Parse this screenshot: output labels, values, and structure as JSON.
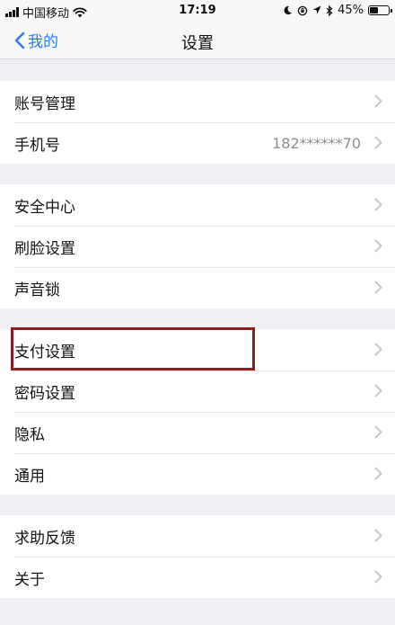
{
  "status_bar": {
    "carrier": "中国移动",
    "time": "17:19",
    "battery_text": "45%",
    "battery_level": 0.45
  },
  "nav": {
    "back_label": "我的",
    "title": "设置"
  },
  "groups": [
    {
      "items": [
        {
          "label": "账号管理",
          "value": ""
        },
        {
          "label": "手机号",
          "value": "182******70"
        }
      ]
    },
    {
      "items": [
        {
          "label": "安全中心",
          "value": ""
        },
        {
          "label": "刷脸设置",
          "value": ""
        },
        {
          "label": "声音锁",
          "value": ""
        }
      ]
    },
    {
      "items": [
        {
          "label": "支付设置",
          "value": ""
        },
        {
          "label": "密码设置",
          "value": ""
        },
        {
          "label": "隐私",
          "value": ""
        },
        {
          "label": "通用",
          "value": ""
        }
      ]
    },
    {
      "items": [
        {
          "label": "求助反馈",
          "value": ""
        },
        {
          "label": "关于",
          "value": ""
        }
      ]
    }
  ],
  "colors": {
    "accent": "#2b7cf4",
    "background": "#efeff4",
    "highlight": "#8f1f1f"
  },
  "icons": [
    "signal-icon",
    "wifi-icon",
    "moon-icon",
    "orientation-lock-icon",
    "location-icon",
    "bluetooth-icon",
    "battery-icon",
    "back-chevron-icon",
    "chevron-right-icon"
  ]
}
